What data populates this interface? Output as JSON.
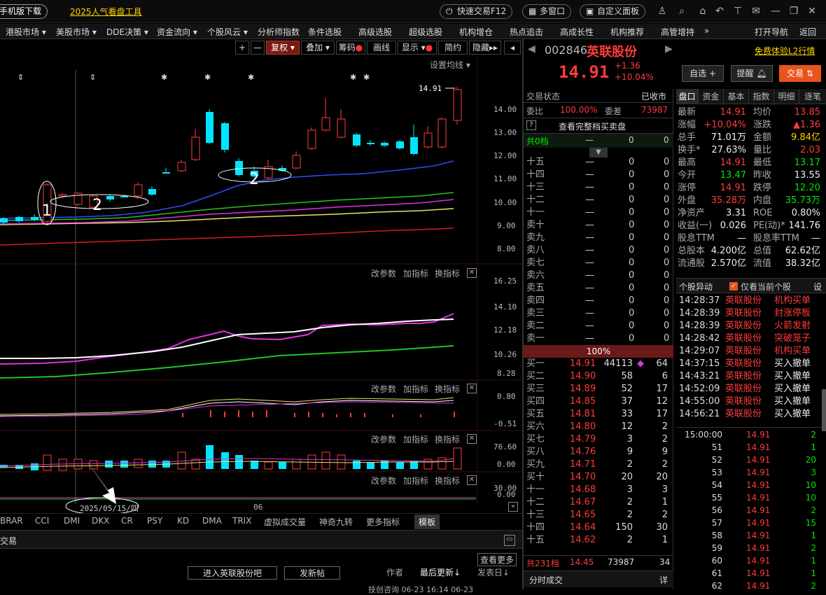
{
  "topbar": {
    "mobile": "手机版下载",
    "tool": "2025人气看盘工具",
    "quick": "快速交易F12",
    "multi": "多窗口",
    "custom": "自定义面板"
  },
  "nav": [
    "港股市场",
    "美股市场",
    "DDE决策",
    "资金流向",
    "个股风云",
    "分析师指数",
    "条件选股",
    "高级选股",
    "超级选股",
    "机构增仓",
    "热点追击",
    "高成长性",
    "机构推荐",
    "高管增持"
  ],
  "nav_right": [
    "打开导航",
    "返回"
  ],
  "chart_toolbar": {
    "plus": "+",
    "minus": "—",
    "fq": "复权",
    "overlay": "叠加",
    "chip": "筹码",
    "draw": "画线",
    "show": "显示",
    "simple": "简约",
    "hide": "隐藏",
    "ma_setting": "设置均线"
  },
  "price_axis": [
    "14.00",
    "13.00",
    "12.00",
    "11.00",
    "10.00",
    "9.00",
    "8.00"
  ],
  "last_price_label": "14.91",
  "ind1_axis": [
    "16.25",
    "14.10",
    "12.18",
    "10.26",
    "8.28"
  ],
  "ind2_axis": [
    "0.80",
    "-0.51"
  ],
  "ind3_axis": [
    "76.60",
    "0.00"
  ],
  "ind4_axis": [
    "30.00",
    "0.00"
  ],
  "panel_buttons": {
    "param": "改参数",
    "add": "加指标",
    "switch": "换指标"
  },
  "x_date": "2025/05/15/四",
  "x_month": "06",
  "annotations": {
    "n1": "1",
    "n2a": "2",
    "n2b": "2"
  },
  "indicator_tabs": [
    "BRAR",
    "CCI",
    "DMI",
    "DKX",
    "CR",
    "PSY",
    "KD",
    "DMA",
    "TRIX",
    "虚拟成交量",
    "神奇九转",
    "更多指标",
    "模板"
  ],
  "bottom": {
    "tab": "交易",
    "more": "查看更多",
    "enter_bar": "进入英联股份吧",
    "post": "发新帖",
    "author": "作者",
    "last_update": "最后更新↓",
    "sent_date": "发表日↓",
    "row": "技创咨询  06-23 16:14  06-23"
  },
  "stock": {
    "code": "002846",
    "name": "英联股份",
    "free_l2": "免费体验L2行情",
    "price": "14.91",
    "chg": "+1.36",
    "pct": "+10.04%",
    "watch": "自选 +",
    "alert": "提醒",
    "trade": "交易"
  },
  "status": {
    "label": "交易状态",
    "value": "已收市",
    "weibi_label": "委比",
    "weibi": "100.00%",
    "weicha_label": "委差",
    "weicha": "73987",
    "full_depth": "查看完整档买卖盘",
    "total0": "共0档",
    "dash": "—",
    "zero": "0"
  },
  "sells": [
    "十五",
    "十四",
    "十三",
    "十二",
    "十一",
    "卖十",
    "卖九",
    "卖八",
    "卖七",
    "卖六",
    "卖五",
    "卖四",
    "卖三",
    "卖二",
    "卖一"
  ],
  "bar_pct": "100%",
  "buys": [
    {
      "l": "买一",
      "p": "14.91",
      "v": "44113",
      "n": "64"
    },
    {
      "l": "买二",
      "p": "14.90",
      "v": "58",
      "n": "6"
    },
    {
      "l": "买三",
      "p": "14.89",
      "v": "52",
      "n": "17"
    },
    {
      "l": "买四",
      "p": "14.85",
      "v": "37",
      "n": "12"
    },
    {
      "l": "买五",
      "p": "14.81",
      "v": "33",
      "n": "17"
    },
    {
      "l": "买六",
      "p": "14.80",
      "v": "12",
      "n": "2"
    },
    {
      "l": "买七",
      "p": "14.79",
      "v": "3",
      "n": "2"
    },
    {
      "l": "买八",
      "p": "14.76",
      "v": "9",
      "n": "9"
    },
    {
      "l": "买九",
      "p": "14.71",
      "v": "2",
      "n": "2"
    },
    {
      "l": "买十",
      "p": "14.70",
      "v": "20",
      "n": "20"
    },
    {
      "l": "十一",
      "p": "14.68",
      "v": "3",
      "n": "3"
    },
    {
      "l": "十二",
      "p": "14.67",
      "v": "2",
      "n": "1"
    },
    {
      "l": "十三",
      "p": "14.65",
      "v": "2",
      "n": "2"
    },
    {
      "l": "十四",
      "p": "14.64",
      "v": "150",
      "n": "30"
    },
    {
      "l": "十五",
      "p": "14.62",
      "v": "2",
      "n": "1"
    }
  ],
  "total231": {
    "l": "共231档",
    "p": "14.45",
    "v": "73987",
    "n": "34"
  },
  "fenshi": {
    "label": "分时成交",
    "detail": "详"
  },
  "quote_tabs": [
    "盘口",
    "资金",
    "基本",
    "指数",
    "明细",
    "逐笔"
  ],
  "quote": [
    {
      "a": "最新",
      "av": "14.91",
      "ac": "red",
      "b": "均价",
      "bv": "13.85",
      "bc": "red"
    },
    {
      "a": "涨幅",
      "av": "+10.04%",
      "ac": "red",
      "b": "涨跌",
      "bv": "▲1.36",
      "bc": "red"
    },
    {
      "a": "总手",
      "av": "71.01万",
      "ac": "white",
      "b": "金额",
      "bv": "9.84亿",
      "bc": "yellow"
    },
    {
      "a": "换手*",
      "av": "27.63%",
      "ac": "white",
      "b": "量比",
      "bv": "2.03",
      "bc": "red"
    },
    {
      "a": "最高",
      "av": "14.91",
      "ac": "red",
      "b": "最低",
      "bv": "13.17",
      "bc": "green"
    },
    {
      "a": "今开",
      "av": "13.47",
      "ac": "green",
      "b": "昨收",
      "bv": "13.55",
      "bc": "white"
    },
    {
      "a": "涨停",
      "av": "14.91",
      "ac": "red",
      "b": "跌停",
      "bv": "12.20",
      "bc": "green"
    },
    {
      "a": "外盘",
      "av": "35.28万",
      "ac": "red",
      "b": "内盘",
      "bv": "35.73万",
      "bc": "green"
    },
    {
      "a": "净资产",
      "av": "3.31",
      "ac": "white",
      "b": "ROE",
      "bv": "0.80%",
      "bc": "white"
    },
    {
      "a": "收益(一)",
      "av": "0.026",
      "ac": "white",
      "b": "PE(动)*",
      "bv": "141.76",
      "bc": "white"
    },
    {
      "a": "股息TTM",
      "av": "—",
      "ac": "white",
      "b": "股息率TTM",
      "bv": "—",
      "bc": "white"
    },
    {
      "a": "总股本",
      "av": "4.200亿",
      "ac": "white",
      "b": "总值",
      "bv": "62.62亿",
      "bc": "white"
    },
    {
      "a": "流通股",
      "av": "2.570亿",
      "ac": "white",
      "b": "流值",
      "bv": "38.32亿",
      "bc": "white"
    }
  ],
  "alerts_header": {
    "title": "个股异动",
    "only": "仅看当前个股",
    "settings": "设"
  },
  "alerts": [
    {
      "t": "14:28:37",
      "n": "英联股份",
      "e": "机构买单",
      "c": "red"
    },
    {
      "t": "14:28:39",
      "n": "英联股份",
      "e": "封涨停板",
      "c": "red"
    },
    {
      "t": "14:28:39",
      "n": "英联股份",
      "e": "火箭发射",
      "c": "red"
    },
    {
      "t": "14:28:42",
      "n": "英联股份",
      "e": "突破笼子",
      "c": "red"
    },
    {
      "t": "14:29:07",
      "n": "英联股份",
      "e": "机构买单",
      "c": "red"
    },
    {
      "t": "14:37:15",
      "n": "英联股份",
      "e": "买入撤单",
      "c": "white"
    },
    {
      "t": "14:43:21",
      "n": "英联股份",
      "e": "买入撤单",
      "c": "white"
    },
    {
      "t": "14:52:09",
      "n": "英联股份",
      "e": "买入撤单",
      "c": "white"
    },
    {
      "t": "14:55:00",
      "n": "英联股份",
      "e": "买入撤单",
      "c": "white"
    },
    {
      "t": "14:56:21",
      "n": "英联股份",
      "e": "买入撤单",
      "c": "white"
    }
  ],
  "ticks": [
    {
      "t": "15:00:00",
      "p": "14.91",
      "v": "2"
    },
    {
      "t": "51",
      "p": "14.91",
      "v": "1"
    },
    {
      "t": "52",
      "p": "14.91",
      "v": "20"
    },
    {
      "t": "53",
      "p": "14.91",
      "v": "3"
    },
    {
      "t": "54",
      "p": "14.91",
      "v": "10"
    },
    {
      "t": "55",
      "p": "14.91",
      "v": "10"
    },
    {
      "t": "56",
      "p": "14.91",
      "v": "2"
    },
    {
      "t": "57",
      "p": "14.91",
      "v": "15"
    },
    {
      "t": "58",
      "p": "14.91",
      "v": "1"
    },
    {
      "t": "59",
      "p": "14.91",
      "v": "2"
    },
    {
      "t": "60",
      "p": "14.91",
      "v": "1"
    },
    {
      "t": "61",
      "p": "14.91",
      "v": "1"
    },
    {
      "t": "62",
      "p": "14.91",
      "v": "2"
    }
  ],
  "colors": {
    "up": "#ff3b3b",
    "down": "#00e5ff",
    "accent": "#e8551b",
    "bg": "#000000"
  }
}
